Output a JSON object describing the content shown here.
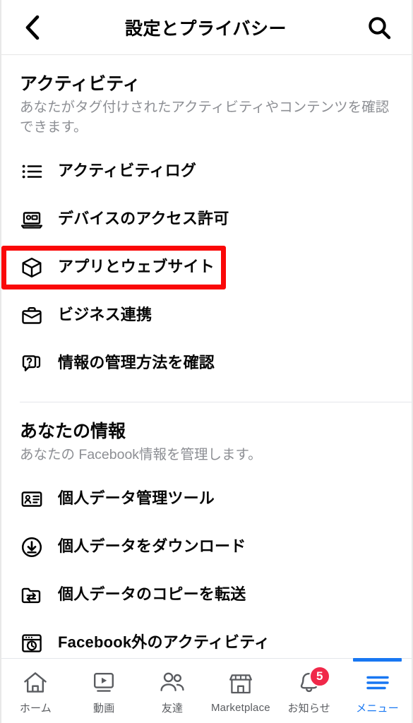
{
  "header": {
    "back_icon": "chevron-left-icon",
    "title": "設定とプライバシー",
    "search_icon": "search-icon"
  },
  "sections": [
    {
      "title": "アクティビティ",
      "description": "あなたがタグ付けされたアクティビティやコンテンツを確認できます。",
      "items": [
        {
          "label": "アクティビティログ",
          "icon": "list-icon",
          "highlighted": false
        },
        {
          "label": "デバイスのアクセス許可",
          "icon": "laptop-icon",
          "highlighted": false
        },
        {
          "label": "アプリとウェブサイト",
          "icon": "cube-icon",
          "highlighted": true
        },
        {
          "label": "ビジネス連携",
          "icon": "briefcase-icon",
          "highlighted": false
        },
        {
          "label": "情報の管理方法を確認",
          "icon": "question-bubble-icon",
          "highlighted": false
        }
      ]
    },
    {
      "title": "あなたの情報",
      "description": "あなたの Facebook情報を管理します。",
      "items": [
        {
          "label": "個人データ管理ツール",
          "icon": "id-card-icon",
          "highlighted": false
        },
        {
          "label": "個人データをダウンロード",
          "icon": "download-circle-icon",
          "highlighted": false
        },
        {
          "label": "個人データのコピーを転送",
          "icon": "folder-transfer-icon",
          "highlighted": false
        },
        {
          "label": "Facebook外のアクティビティ",
          "icon": "browser-history-icon",
          "highlighted": false
        }
      ]
    }
  ],
  "tabbar": {
    "items": [
      {
        "label": "ホーム",
        "icon": "home-icon",
        "active": false,
        "badge": ""
      },
      {
        "label": "動画",
        "icon": "video-icon",
        "active": false,
        "badge": ""
      },
      {
        "label": "友達",
        "icon": "friends-icon",
        "active": false,
        "badge": ""
      },
      {
        "label": "Marketplace",
        "icon": "store-icon",
        "active": false,
        "badge": ""
      },
      {
        "label": "お知らせ",
        "icon": "bell-icon",
        "active": false,
        "badge": "5"
      },
      {
        "label": "メニュー",
        "icon": "hamburger-menu-icon",
        "active": true,
        "badge": ""
      }
    ]
  },
  "colors": {
    "accent_blue": "#1877f2",
    "highlight_red": "#fa0808",
    "badge_red": "#f02849",
    "text_primary": "#070707",
    "text_secondary": "#8d8f94"
  }
}
